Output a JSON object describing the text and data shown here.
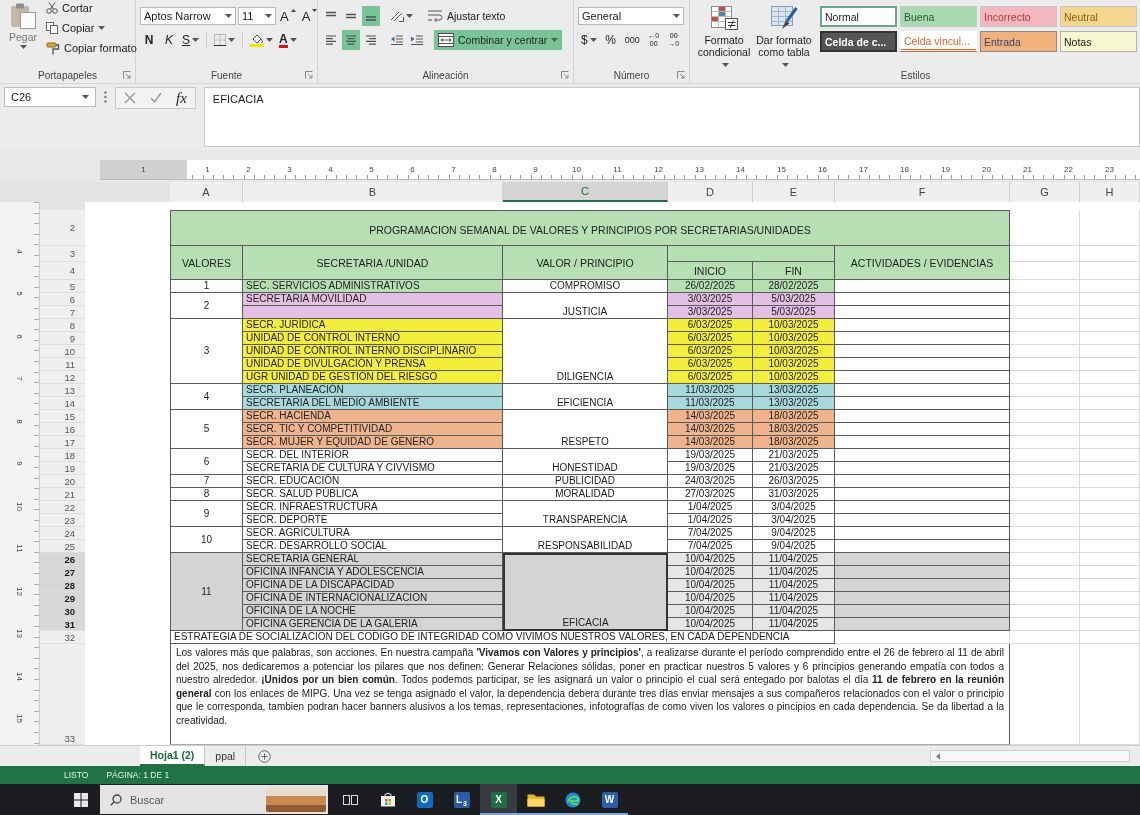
{
  "ribbon": {
    "clipboard": {
      "paste": "Pegar",
      "cut": "Cortar",
      "copy": "Copiar",
      "format_painter": "Copiar formato",
      "label": "Portapapeles"
    },
    "font": {
      "family": "Aptos Narrow",
      "size": "11",
      "grow": "A",
      "shrink": "A",
      "bold": "N",
      "italic": "K",
      "underline": "S",
      "font_color": "A",
      "label": "Fuente"
    },
    "alignment": {
      "vertical": [
        {
          "kind": "top",
          "selected": false
        },
        {
          "kind": "middle",
          "selected": false
        },
        {
          "kind": "bottom",
          "selected": true
        }
      ],
      "horizontal": [
        {
          "kind": "left",
          "selected": false
        },
        {
          "kind": "center",
          "selected": true
        },
        {
          "kind": "right",
          "selected": false
        }
      ],
      "wrap_text": {
        "label": "Ajustar texto",
        "selected": false
      },
      "merge": {
        "label": "Combinar y centrar",
        "selected": true
      },
      "label": "Alineación"
    },
    "number": {
      "format": "General",
      "buttons": [
        {
          "kind": "currency",
          "label": "$"
        },
        {
          "kind": "percent",
          "label": "%"
        },
        {
          "kind": "thousands",
          "label": "000"
        },
        {
          "kind": "decimal_increase",
          "lines": [
            "←0",
            "00"
          ]
        },
        {
          "kind": "decimal_decrease",
          "lines": [
            "00",
            "→0"
          ]
        }
      ],
      "label": "Número"
    },
    "styles": {
      "conditional_format": "Formato condicional",
      "format_as_table": "Dar formato como tabla",
      "items": [
        {
          "label": "Normal",
          "kind": "normal",
          "selected": true
        },
        {
          "label": "Buena",
          "kind": "good",
          "selected": false
        },
        {
          "label": "Incorrecto",
          "kind": "bad",
          "selected": false
        },
        {
          "label": "Neutral",
          "kind": "neutral",
          "selected": false
        },
        {
          "label": "Celda de c...",
          "kind": "check",
          "selected": false
        },
        {
          "label": "Celda vincul...",
          "kind": "linked",
          "selected": false
        },
        {
          "label": "Entrada",
          "kind": "input",
          "selected": false
        },
        {
          "label": "Notas",
          "kind": "note",
          "selected": false
        }
      ],
      "label": "Estilos"
    }
  },
  "formula_bar": {
    "name_box": "C26",
    "function_button": "fx",
    "value": "EFICACIA"
  },
  "horizontal_ruler": {
    "numbers": [
      "1",
      "1",
      "2",
      "3",
      "4",
      "5",
      "6",
      "7",
      "8",
      "9",
      "10",
      "11",
      "12",
      "13",
      "14",
      "15",
      "16",
      "17",
      "18",
      "19",
      "20",
      "21",
      "22",
      "23"
    ]
  },
  "vertical_ruler": {
    "numbers": [
      "4",
      "5",
      "6",
      "7",
      "8",
      "9",
      "10",
      "11",
      "12",
      "13",
      "14",
      "15"
    ]
  },
  "columns": [
    {
      "letter": "A",
      "selected": false
    },
    {
      "letter": "B",
      "selected": false
    },
    {
      "letter": "C",
      "selected": true
    },
    {
      "letter": "D",
      "selected": false
    },
    {
      "letter": "E",
      "selected": false
    },
    {
      "letter": "F",
      "selected": false
    },
    {
      "letter": "G",
      "selected": false
    },
    {
      "letter": "H",
      "selected": false
    }
  ],
  "row_numbers": [
    {
      "label": "2",
      "selected": false
    },
    {
      "label": "3",
      "selected": false
    },
    {
      "label": "4",
      "selected": false
    },
    {
      "label": "5",
      "selected": false
    },
    {
      "label": "6",
      "selected": false
    },
    {
      "label": "7",
      "selected": false
    },
    {
      "label": "8",
      "selected": false
    },
    {
      "label": "9",
      "selected": false
    },
    {
      "label": "10",
      "selected": false
    },
    {
      "label": "11",
      "selected": false
    },
    {
      "label": "12",
      "selected": false
    },
    {
      "label": "13",
      "selected": false
    },
    {
      "label": "14",
      "selected": false
    },
    {
      "label": "15",
      "selected": false
    },
    {
      "label": "16",
      "selected": false
    },
    {
      "label": "17",
      "selected": false
    },
    {
      "label": "18",
      "selected": false
    },
    {
      "label": "19",
      "selected": false
    },
    {
      "label": "20",
      "selected": false
    },
    {
      "label": "21",
      "selected": false
    },
    {
      "label": "22",
      "selected": false
    },
    {
      "label": "23",
      "selected": false
    },
    {
      "label": "24",
      "selected": false
    },
    {
      "label": "25",
      "selected": false
    },
    {
      "label": "26",
      "selected": true
    },
    {
      "label": "27",
      "selected": true
    },
    {
      "label": "28",
      "selected": true
    },
    {
      "label": "29",
      "selected": true
    },
    {
      "label": "30",
      "selected": true
    },
    {
      "label": "31",
      "selected": true
    },
    {
      "label": "32",
      "selected": false
    },
    {
      "label": "33",
      "selected": false
    }
  ],
  "table": {
    "title": "PROGRAMACION SEMANAL DE VALORES Y PRINCIPIOS POR SECRETARIAS/UNIDADES",
    "columns": [
      "VALORES",
      "SECRETARIA /UNIDAD",
      "VALOR / PRINCIPIO",
      "INICIO",
      "FIN",
      "ACTIVIDADES / EVIDENCIAS"
    ],
    "groups": [
      {
        "number": "1",
        "principle": "COMPROMISO",
        "color": "#b5deb1",
        "selected": false,
        "rows": [
          {
            "unit": "SEC. SERVICIOS ADMINISTRATIVOS",
            "start": "26/02/2025",
            "end": "28/02/2025"
          }
        ]
      },
      {
        "number": "2",
        "principle": "JUSTICIA",
        "color": "#e4bfe4",
        "selected": false,
        "rows": [
          {
            "unit": "SECRETARIA MOVILIDAD",
            "start": "3/03/2025",
            "end": "5/03/2025"
          },
          {
            "start": "3/03/2025",
            "end": "5/03/2025"
          }
        ]
      },
      {
        "number": "3",
        "principle": "DILIGENCIA",
        "color": "#f3ee3a",
        "selected": false,
        "rows": [
          {
            "unit": "SECR. JURÍDICA",
            "start": "6/03/2025",
            "end": "10/03/2025"
          },
          {
            "unit": "UNIDAD DE CONTROL INTERNO",
            "start": "6/03/2025",
            "end": "10/03/2025"
          },
          {
            "unit": "UNIDAD DE CONTROL INTERNO DISCIPLINARIO",
            "start": "6/03/2025",
            "end": "10/03/2025"
          },
          {
            "unit": "UNIDAD DE DIVULGACIÓN Y PRENSA",
            "start": "6/03/2025",
            "end": "10/03/2025"
          },
          {
            "unit": "UGR UNIDAD DE GESTIÓN DEL RIESGO",
            "start": "6/03/2025",
            "end": "10/03/2025"
          }
        ]
      },
      {
        "number": "4",
        "principle": "EFICIENCIA",
        "color": "#a6d8dc",
        "selected": false,
        "rows": [
          {
            "unit": "SECR. PLANEACIÓN",
            "start": "11/03/2025",
            "end": "13/03/2025"
          },
          {
            "unit": "SECRETARIA DEL MEDIO AMBIENTE",
            "start": "11/03/2025",
            "end": "13/03/2025"
          }
        ]
      },
      {
        "number": "5",
        "principle": "RESPETO",
        "color": "#efb48e",
        "selected": false,
        "rows": [
          {
            "unit": "SECR. HACIENDA",
            "start": "14/03/2025",
            "end": "18/03/2025"
          },
          {
            "unit": "SECR. TIC Y COMPETITIVIDAD",
            "start": "14/03/2025",
            "end": "18/03/2025"
          },
          {
            "unit": "SECR. MUJER Y EQUIDAD DE GÉNERO",
            "start": "14/03/2025",
            "end": "18/03/2025"
          }
        ]
      },
      {
        "number": "6",
        "principle": "HONESTIDAD",
        "selected": false,
        "rows": [
          {
            "unit": "SECR. DEL INTERIOR",
            "start": "19/03/2025",
            "end": "21/03/2025"
          },
          {
            "unit": "SECRETARIA DE CULTURA Y CIVVISMO",
            "start": "19/03/2025",
            "end": "21/03/2025"
          }
        ]
      },
      {
        "number": "7",
        "principle": "PUBLICIDAD",
        "selected": false,
        "rows": [
          {
            "unit": "SECR. EDUCACIÓN",
            "start": "24/03/2025",
            "end": "26/03/2025"
          }
        ]
      },
      {
        "number": "8",
        "principle": "MORALIDAD",
        "selected": false,
        "rows": [
          {
            "unit": "SECR. SALUD PÚBLICA",
            "start": "27/03/2025",
            "end": "31/03/2025"
          }
        ]
      },
      {
        "number": "9",
        "principle": "TRANSPARENCIA",
        "selected": false,
        "rows": [
          {
            "unit": "SECR. INFRAESTRUCTURA",
            "start": "1/04/2025",
            "end": "3/04/2025"
          },
          {
            "unit": "SECR. DEPORTE",
            "start": "1/04/2025",
            "end": "3/04/2025"
          }
        ]
      },
      {
        "number": "10",
        "principle": "RESPONSABILIDAD",
        "selected": false,
        "rows": [
          {
            "unit": "SECR. AGRICULTURA",
            "start": "7/04/2025",
            "end": "9/04/2025"
          },
          {
            "unit": "SECR. DESARROLLO SOCIAL",
            "start": "7/04/2025",
            "end": "9/04/2025"
          }
        ]
      },
      {
        "number": "11",
        "principle": "EFICACIA",
        "selected": true,
        "rows": [
          {
            "unit": "SECRETARIA GENERAL",
            "start": "10/04/2025",
            "end": "11/04/2025"
          },
          {
            "unit": "OFICINA INFANCIA Y ADOLESCENCIA",
            "start": "10/04/2025",
            "end": "11/04/2025"
          },
          {
            "unit": "OFICINA DE LA DISCAPACIDAD",
            "start": "10/04/2025",
            "end": "11/04/2025"
          },
          {
            "unit": "OFICINA DE INTERNACIONALIZACION",
            "start": "10/04/2025",
            "end": "11/04/2025"
          },
          {
            "unit": "OFICINA DE LA NOCHE",
            "start": "10/04/2025",
            "end": "11/04/2025"
          },
          {
            "unit": "OFICINA GERENCIA DE LA GALERIA",
            "start": "10/04/2025",
            "end": "11/04/2025"
          }
        ]
      }
    ],
    "footer_heading": "ESTRATEGIA DE SOCIALIZACION DEL CODIGO DE INTEGRIDAD COMO VIVIMOS NUESTROS VALORES, EN CADA DEPENDENCIA",
    "footer_text": "Los valores más que palabras, son acciones. En nuestra campaña **'Vivamos con Valores y principios'**, a realizarse durante el período comprendido entre el 26 de febrero al 11 de abril del 2025, nos dedicaremos a potenciar los pilares que nos definen: Generar Relaciones sólidas, poner en practicar nuestros 5 valores y 6 principios generando empatía con todos a nuestro alrededor. **¡Unidos por un bien común**. Todos podemos participar, se les asignará un valor o principio el cual será entegado por balotas el día **11 de febrero en la reunión general** con los enlaces de MIPG. Una vez se tenga asignado el valor, la dependencia debera durante tres días enviar mensajes a sus compañeros relacionados con el valor o principio que le corresponda, tambien podran hacer banners alusivos a los temas, representaciones, infotografías de como viven los valores o pincipios en cada dependencia. Se da libertad a la creatividad."
  },
  "sheet_tabs": [
    {
      "label": "Hoja1 (2)",
      "selected": true
    },
    {
      "label": "ppal",
      "selected": false
    }
  ],
  "status_bar": {
    "mode": "LISTO",
    "page": "PÁGINA: 1 DE 1"
  },
  "taskbar": {
    "search": {
      "placeholder": "Buscar"
    },
    "apps": [
      {
        "kind": "task_view",
        "selected": false,
        "running": false
      },
      {
        "kind": "store",
        "selected": false,
        "running": false
      },
      {
        "kind": "mail",
        "label": "O",
        "selected": false,
        "running": false
      },
      {
        "kind": "chat",
        "label": "L",
        "badge": "3",
        "selected": false,
        "running": false
      },
      {
        "kind": "spreadsheet",
        "label": "X",
        "selected": true,
        "running": true
      },
      {
        "kind": "folder",
        "selected": false,
        "running": true
      },
      {
        "kind": "browser",
        "selected": false,
        "running": true
      },
      {
        "kind": "document",
        "label": "W",
        "selected": false,
        "running": true
      }
    ]
  }
}
